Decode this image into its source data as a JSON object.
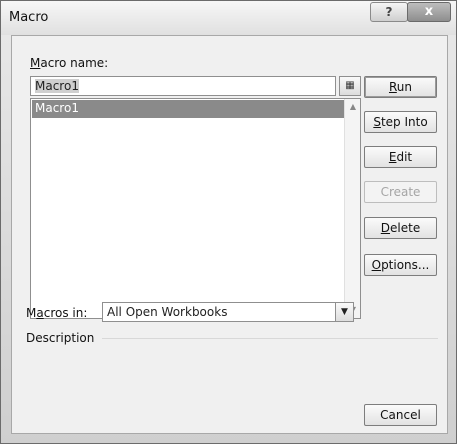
{
  "window": {
    "title": "Macro",
    "help_glyph": "?",
    "close_glyph": "x"
  },
  "macro_name": {
    "label_mnemonic": "M",
    "label_rest": "acro name:",
    "value": "Macro1",
    "picker_icon": "range-picker-icon"
  },
  "macro_list": {
    "items": [
      "Macro1"
    ]
  },
  "buttons": {
    "run": {
      "mnemonic": "R",
      "rest": "un"
    },
    "step_into": {
      "mnemonic": "S",
      "rest": "tep Into"
    },
    "edit": {
      "mnemonic": "E",
      "rest": "dit"
    },
    "create": {
      "label": "Create"
    },
    "delete": {
      "mnemonic": "D",
      "rest": "elete"
    },
    "options": {
      "mnemonic": "O",
      "rest": "ptions..."
    },
    "cancel": {
      "label": "Cancel"
    }
  },
  "macros_in": {
    "label_pre": "M",
    "label_mnemonic": "a",
    "label_rest": "cros in:",
    "selected": "All Open Workbooks"
  },
  "description": {
    "label": "Description"
  }
}
